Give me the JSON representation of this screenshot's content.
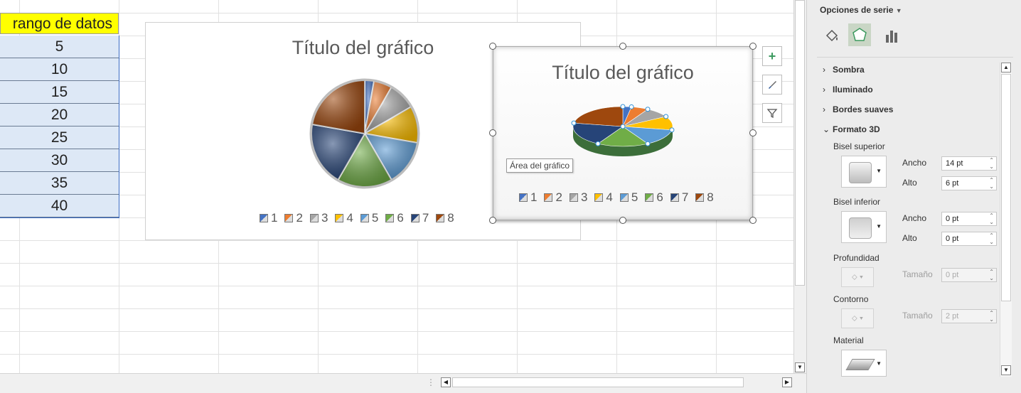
{
  "sheet": {
    "header": "rango de datos",
    "values": [
      "5",
      "10",
      "15",
      "20",
      "25",
      "30",
      "35",
      "40"
    ]
  },
  "chart1": {
    "title": "Título del gráfico",
    "legend": [
      "1",
      "2",
      "3",
      "4",
      "5",
      "6",
      "7",
      "8"
    ]
  },
  "chart2": {
    "title": "Título del gráfico",
    "legend": [
      "1",
      "2",
      "3",
      "4",
      "5",
      "6",
      "7",
      "8"
    ],
    "tooltip": "Área del gráfico"
  },
  "series_colors": [
    "#4472c4",
    "#ed7d31",
    "#a5a5a5",
    "#ffc000",
    "#5b9bd5",
    "#70ad47",
    "#264478",
    "#9e480e"
  ],
  "chart_tools": {
    "add": "+",
    "style": "brush-icon",
    "filter": "filter-icon"
  },
  "panel": {
    "title": "Opciones de serie",
    "sections": {
      "shadow": "Sombra",
      "glow": "Iluminado",
      "soft_edges": "Bordes suaves",
      "format3d": "Formato 3D"
    },
    "bevel_top": {
      "label": "Bisel superior",
      "width_label": "Ancho",
      "width": "14 pt",
      "height_label": "Alto",
      "height": "6 pt"
    },
    "bevel_bottom": {
      "label": "Bisel inferior",
      "width_label": "Ancho",
      "width": "0 pt",
      "height_label": "Alto",
      "height": "0 pt"
    },
    "depth": {
      "label": "Profundidad",
      "size_label": "Tamaño",
      "size": "0 pt"
    },
    "contour": {
      "label": "Contorno",
      "size_label": "Tamaño",
      "size": "2 pt"
    },
    "material": {
      "label": "Material"
    }
  }
}
